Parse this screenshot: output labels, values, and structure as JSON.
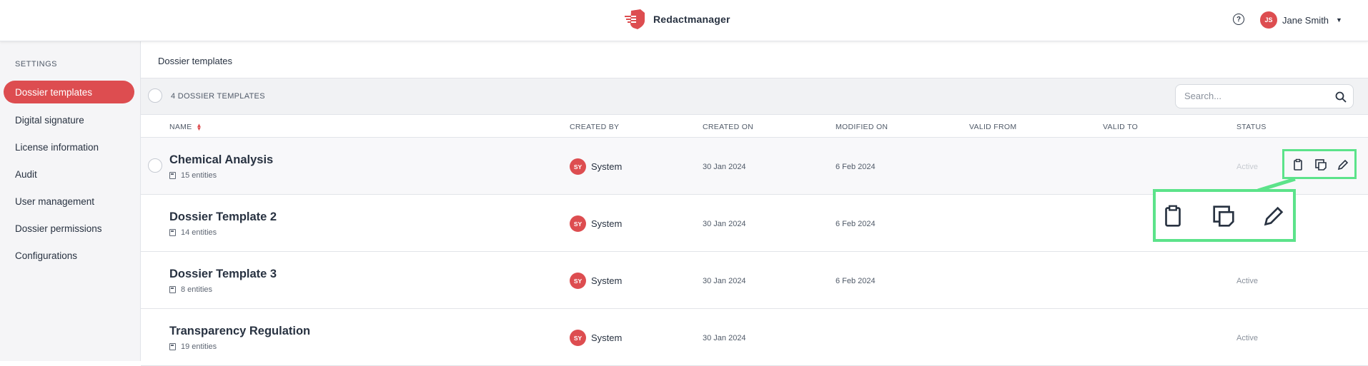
{
  "app": {
    "name": "Redactmanager"
  },
  "user": {
    "initials": "JS",
    "name": "Jane Smith"
  },
  "sidebar": {
    "heading": "SETTINGS",
    "items": [
      {
        "label": "Dossier templates",
        "active": true
      },
      {
        "label": "Digital signature"
      },
      {
        "label": "License information"
      },
      {
        "label": "Audit"
      },
      {
        "label": "User management"
      },
      {
        "label": "Dossier permissions"
      },
      {
        "label": "Configurations"
      }
    ]
  },
  "page": {
    "title": "Dossier templates"
  },
  "list": {
    "count_label": "4 DOSSIER TEMPLATES",
    "search_placeholder": "Search...",
    "columns": [
      "NAME",
      "CREATED BY",
      "CREATED ON",
      "MODIFIED ON",
      "VALID FROM",
      "VALID TO",
      "STATUS"
    ],
    "rows": [
      {
        "name": "Chemical Analysis",
        "entities": "15 entities",
        "creator_initials": "SY",
        "creator": "System",
        "created_on": "30 Jan 2024",
        "modified_on": "6 Feb 2024",
        "valid_from": "",
        "valid_to": "",
        "status": "Active"
      },
      {
        "name": "Dossier Template 2",
        "entities": "14 entities",
        "creator_initials": "SY",
        "creator": "System",
        "created_on": "30 Jan 2024",
        "modified_on": "6 Feb 2024",
        "valid_from": "",
        "valid_to": "",
        "status": ""
      },
      {
        "name": "Dossier Template 3",
        "entities": "8 entities",
        "creator_initials": "SY",
        "creator": "System",
        "created_on": "30 Jan 2024",
        "modified_on": "6 Feb 2024",
        "valid_from": "",
        "valid_to": "",
        "status": "Active"
      },
      {
        "name": "Transparency Regulation",
        "entities": "19 entities",
        "creator_initials": "SY",
        "creator": "System",
        "created_on": "30 Jan 2024",
        "modified_on": "",
        "valid_from": "",
        "valid_to": "",
        "status": "Active"
      }
    ]
  },
  "row_actions": {
    "icons": [
      "delete-icon",
      "clone-icon",
      "edit-icon"
    ]
  },
  "colors": {
    "accent": "#dd4d50",
    "highlight": "#5ce38a",
    "text": "#283241"
  }
}
